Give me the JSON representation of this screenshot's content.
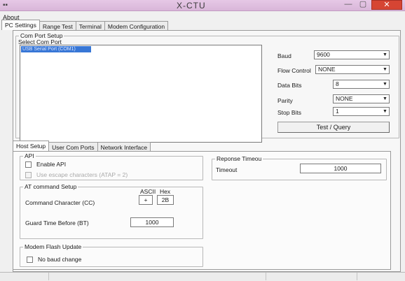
{
  "window": {
    "title": "X-CTU",
    "app_icon": "app-icon",
    "minimize_glyph": "—",
    "maximize_glyph": "▢",
    "close_glyph": "✕"
  },
  "menu": {
    "about": "About"
  },
  "top_tabs": [
    "PC Settings",
    "Range Test",
    "Terminal",
    "Modem Configuration"
  ],
  "com_port_setup": {
    "group_title": "Com Port Setup",
    "select_label": "Select Com Port",
    "ports": [
      "USB Serial Port (COM1)"
    ],
    "selected_port": "USB Serial Port (COM1)",
    "baud_label": "Baud",
    "baud_value": "9600",
    "flow_control_label": "Flow Control",
    "flow_control_value": "NONE",
    "data_bits_label": "Data Bits",
    "data_bits_value": "8",
    "parity_label": "Parity",
    "parity_value": "NONE",
    "stop_bits_label": "Stop Bits",
    "stop_bits_value": "1",
    "test_query_label": "Test / Query"
  },
  "host_tabs": [
    "Host Setup",
    "User Com Ports",
    "Network Interface"
  ],
  "api": {
    "group_title": "API",
    "enable_api_label": "Enable API",
    "use_escape_label": "Use escape characters (ATAP = 2)"
  },
  "at_command": {
    "group_title": "AT command Setup",
    "ascii_header": "ASCII",
    "hex_header": "Hex",
    "command_char_label": "Command Character (CC)",
    "command_char_ascii": "+",
    "command_char_hex": "2B",
    "guard_time_label": "Guard Time Before (BT)",
    "guard_time_value": "1000"
  },
  "modem_flash": {
    "group_title": "Modem Flash Update",
    "no_baud_change_label": "No baud change"
  },
  "response_timeout": {
    "group_title": "Reponse Timeou",
    "timeout_label": "Timeout",
    "timeout_value": "1000"
  }
}
